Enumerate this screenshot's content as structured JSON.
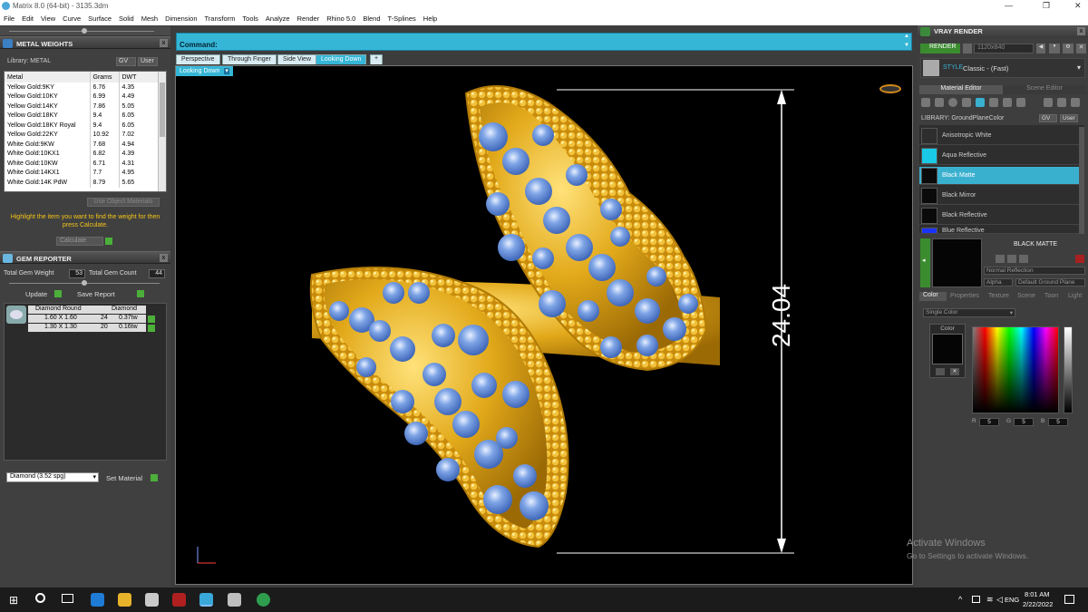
{
  "window": {
    "title": "Matrix 8.0 (64-bit) - 3135.3dm"
  },
  "menu": [
    "File",
    "Edit",
    "View",
    "Curve",
    "Surface",
    "Solid",
    "Mesh",
    "Dimension",
    "Transform",
    "Tools",
    "Analyze",
    "Render",
    "Rhino 5.0",
    "Blend",
    "T-Splines",
    "Help"
  ],
  "metal_weights": {
    "title": "METAL WEIGHTS",
    "library_label": "Library: METAL",
    "gv_label": "GV",
    "user_label": "User",
    "columns": [
      "Metal",
      "Grams",
      "DWT"
    ],
    "rows": [
      [
        "Yellow Gold:9KY",
        "6.76",
        "4.35"
      ],
      [
        "Yellow Gold:10KY",
        "6.99",
        "4.49"
      ],
      [
        "Yellow Gold:14KY",
        "7.86",
        "5.05"
      ],
      [
        "Yellow Gold:18KY",
        "9.4",
        "6.05"
      ],
      [
        "Yellow Gold:18KY Royal",
        "9.4",
        "6.05"
      ],
      [
        "Yellow Gold:22KY",
        "10.92",
        "7.02"
      ],
      [
        "White Gold:9KW",
        "7.68",
        "4.94"
      ],
      [
        "White Gold:10KX1",
        "6.82",
        "4.39"
      ],
      [
        "White Gold:10KW",
        "6.71",
        "4.31"
      ],
      [
        "White Gold:14KX1",
        "7.7",
        "4.95"
      ],
      [
        "White Gold:14K PdW",
        "8.79",
        "5.65"
      ]
    ],
    "use_object_materials": "Use Object Materials",
    "hint": "Highlight the item you want to find the weight for then press Calculate.",
    "calculate": "Calculate"
  },
  "gem_reporter": {
    "title": "GEM REPORTER",
    "total_gem_weight_label": "Total Gem Weight",
    "total_gem_weight": "53",
    "total_gem_count_label": "Total Gem Count",
    "total_gem_count": "44",
    "update": "Update",
    "save_report": "Save Report",
    "columns": [
      "Diamond Round",
      "Diamond"
    ],
    "rows": [
      [
        "1.60 X 1.60",
        "24",
        "0.37tw"
      ],
      [
        "1.30 X 1.30",
        "20",
        "0.16tw"
      ]
    ],
    "material_select": "Diamond    (3.52 spg)",
    "set_material": "Set Material"
  },
  "command": {
    "label": "Command:"
  },
  "viewport_tabs": [
    "Perspective",
    "Through Finger",
    "Side View",
    "Looking Down",
    "+"
  ],
  "active_tab": "Looking Down",
  "viewport_label": "Looking Down",
  "dimension": "24.04",
  "vray": {
    "title": "VRAY RENDER",
    "render_btn": "RENDER",
    "resolution": "1120x840",
    "style_label": "STYLE",
    "style_value": "Classic - (Fast)",
    "tabs": [
      "Material Editor",
      "Scene Editor"
    ],
    "library_label": "LIBRARY: GroundPlaneColor",
    "gv_label": "GV",
    "user_label": "User",
    "materials": [
      {
        "name": "Anisotropic White",
        "color": "#1a1a1a"
      },
      {
        "name": "Aqua Reflective",
        "color": "#19c9e6"
      },
      {
        "name": "Black Matte",
        "color": "#0a0a0a"
      },
      {
        "name": "Black Mirror",
        "color": "#0a0a0a"
      },
      {
        "name": "Black Reflective",
        "color": "#0a0a0a"
      },
      {
        "name": "Blue Reflective",
        "color": "#1a34ff"
      }
    ],
    "selected_material": "BLACK MATTE",
    "normal_reflection": "Normal Reflection",
    "alpha": "Alpha",
    "default_ground_plane": "Default Ground Plane",
    "bottom_tabs": [
      "Color",
      "Properties",
      "Texture",
      "Scene",
      "Toon",
      "Light"
    ],
    "color_mode": "Single Color",
    "color_label": "Color",
    "rgb": {
      "r": "5",
      "g": "5",
      "b": "5"
    }
  },
  "watermark": {
    "line1": "Activate Windows",
    "line2": "Go to Settings to activate Windows."
  },
  "taskbar": {
    "lang": "ENG",
    "time": "8:01 AM",
    "date": "2/22/2022"
  }
}
